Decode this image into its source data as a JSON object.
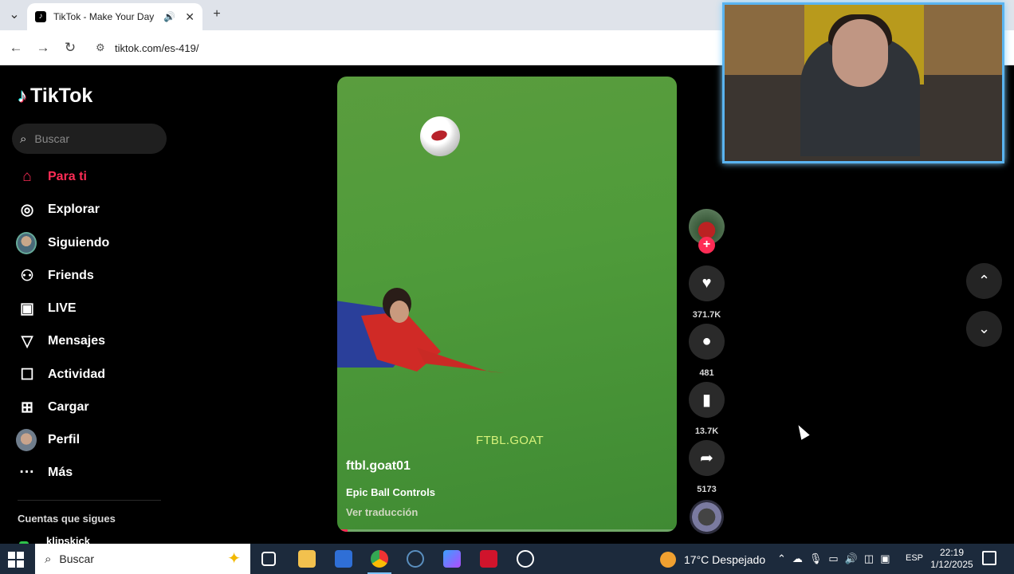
{
  "browser": {
    "tab_title": "TikTok - Make Your Day",
    "url": "tiktok.com/es-419/"
  },
  "tiktok": {
    "logo_text": "TikTok",
    "search_placeholder": "Buscar",
    "nav": [
      {
        "label": "Para ti",
        "icon": "home-icon",
        "active": true
      },
      {
        "label": "Explorar",
        "icon": "compass-icon"
      },
      {
        "label": "Siguiendo",
        "icon": "avatar"
      },
      {
        "label": "Friends",
        "icon": "friends-icon"
      },
      {
        "label": "LIVE",
        "icon": "live-icon"
      },
      {
        "label": "Mensajes",
        "icon": "send-icon"
      },
      {
        "label": "Actividad",
        "icon": "message-box-icon"
      },
      {
        "label": "Cargar",
        "icon": "plus-square-icon"
      },
      {
        "label": "Perfil",
        "icon": "avatar"
      },
      {
        "label": "Más",
        "icon": "more-icon"
      }
    ],
    "following_title": "Cuentas que sigues",
    "following_accounts": [
      "klipskick"
    ],
    "video": {
      "watermark": "FTBL.GOAT",
      "author": "ftbl.goat01",
      "description": "Epic Ball Controls",
      "translate_label": "Ver traducción",
      "progress": 0.03
    },
    "actions": {
      "likes": "371.7K",
      "comments": "481",
      "saves": "13.7K",
      "shares": "5173"
    },
    "accent": "#fe2c55"
  },
  "taskbar": {
    "search_placeholder": "Buscar",
    "weather": "17°C  Despejado",
    "lang": "ESP",
    "time": "22:19",
    "date": "1/12/2025",
    "weather_badge": "1"
  }
}
